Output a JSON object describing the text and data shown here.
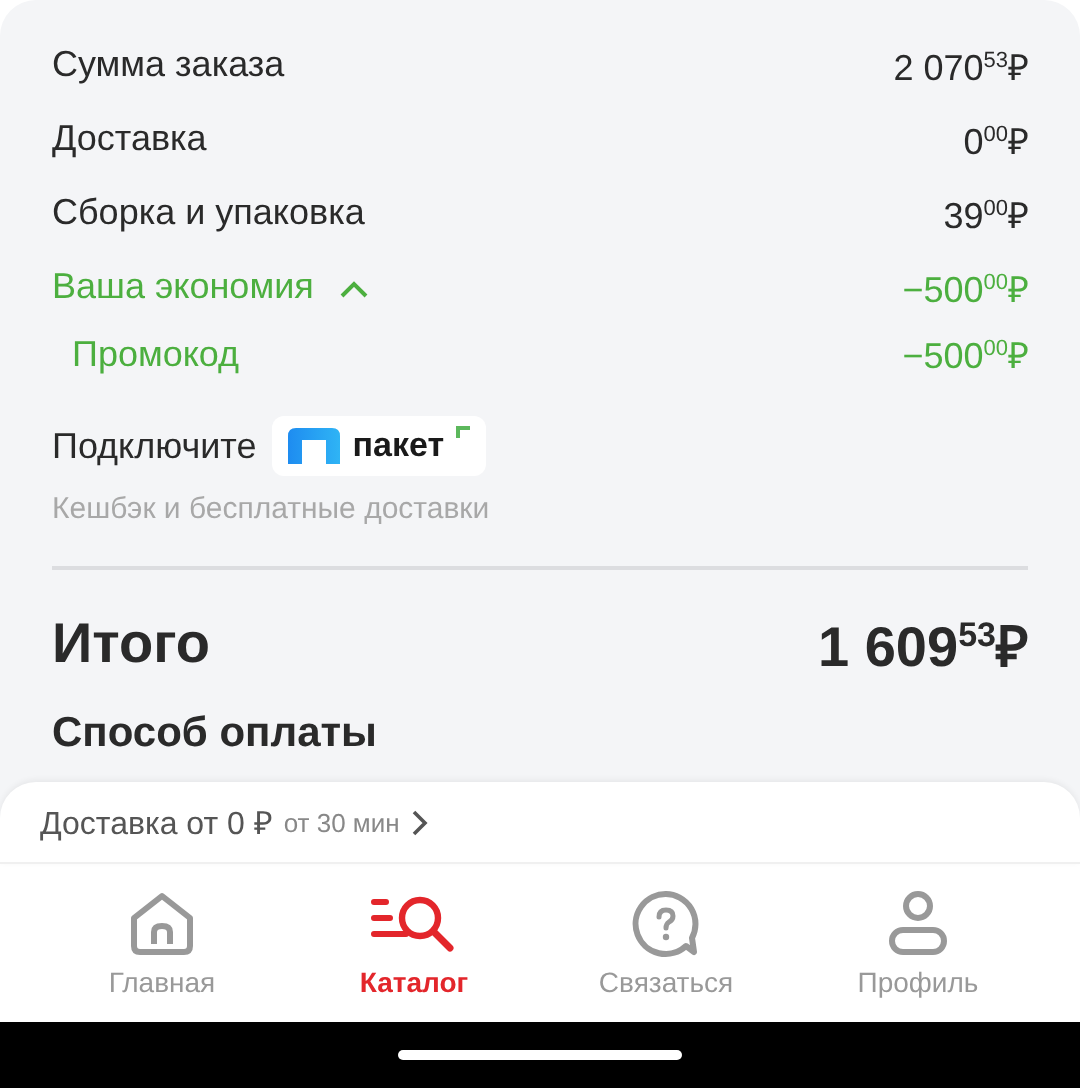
{
  "summary": {
    "rows": [
      {
        "kind": "line",
        "label": "Сумма заказа",
        "amount": "2 070$^{53}$₽"
      },
      {
        "kind": "line",
        "label": "Доставка",
        "amount": "0$^{00}$₽"
      },
      {
        "kind": "line",
        "label": "Сборка и упаковка",
        "amount": "39$^{00}$₽"
      },
      {
        "kind": "saving",
        "label": "Ваша экономия",
        "amount": "−500$^{00}$₽",
        "expanded": true
      },
      {
        "kind": "promo",
        "label": "Промокод",
        "amount": "−500$^{00}$₽"
      }
    ],
    "subscription": {
      "label": "Подключите",
      "brand": "пакет",
      "note": "Кешбэк и бесплатные доставки"
    },
    "total": {
      "label": "Итого",
      "amount": "1 609$^{53}$₽"
    },
    "next_section": "Способ оплаты"
  },
  "delivery_bar": {
    "text": "Доставка от 0 ₽",
    "time": "от 30 мин"
  },
  "nav": [
    {
      "label": "Главная",
      "selected": false
    },
    {
      "label": "Каталог",
      "selected": true
    },
    {
      "label": "Связаться",
      "selected": false
    },
    {
      "label": "Профиль",
      "selected": false
    }
  ]
}
